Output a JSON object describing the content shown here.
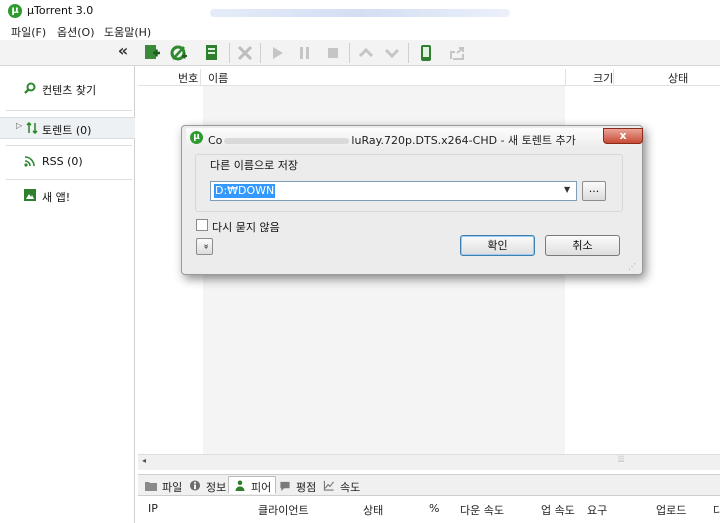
{
  "window": {
    "title": "µTorrent 3.0"
  },
  "menu": [
    "파일(F)",
    "옵션(O)",
    "도움말(H)"
  ],
  "toolbar": {
    "collapse": "«"
  },
  "sidebar": {
    "items": [
      {
        "label": "컨텐츠 찾기"
      },
      {
        "label": "토렌트 (0)"
      },
      {
        "label": "RSS (0)"
      },
      {
        "label": "새 앱!"
      }
    ]
  },
  "list": {
    "columns": [
      "번호",
      "이름",
      "크기",
      "상태"
    ]
  },
  "tabs": [
    "파일",
    "정보",
    "피어",
    "평점",
    "속도"
  ],
  "peers": {
    "columns": [
      "IP",
      "클라이언트",
      "상태",
      "%",
      "다운 속도",
      "업 속도",
      "요구",
      "업로드",
      "다"
    ]
  },
  "dialog": {
    "title_prefix": "Co",
    "title_rest": "luRay.720p.DTS.x264-CHD - 새 토렌트 추가",
    "close": "x",
    "group_label": "다른 이름으로 저장",
    "path_value": "D:₩DOWN",
    "browse": "...",
    "dont_ask": "다시 묻지 않음",
    "ok": "확인",
    "cancel": "취소",
    "expand": "»"
  },
  "colors": {
    "accent": "#2f9a2f",
    "selection": "#3399ff"
  }
}
